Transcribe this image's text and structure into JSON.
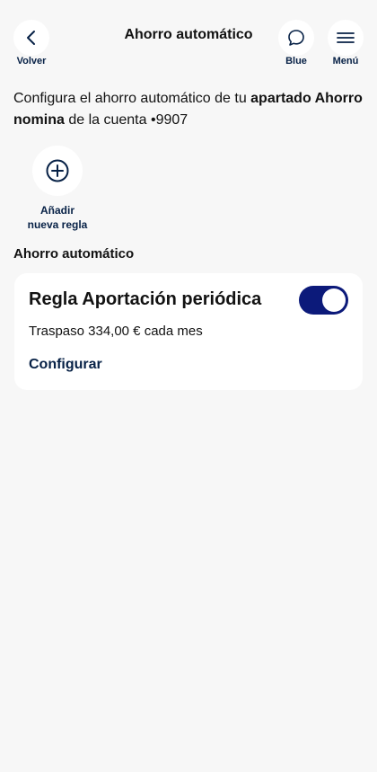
{
  "header": {
    "title": "Ahorro automático",
    "back_label": "Volver",
    "chat_label": "Blue",
    "menu_label": "Menú"
  },
  "intro": {
    "prefix": "Configura el ahorro automático de tu ",
    "bold_part": "apartado Ahorro nomina",
    "suffix": " de la cuenta •9907"
  },
  "add_rule": {
    "label": "Añadir nueva regla"
  },
  "section": {
    "title": "Ahorro automático"
  },
  "rule_card": {
    "title": "Regla Aportación periódica",
    "description": "Traspaso 334,00 € cada mes",
    "link_label": "Configurar",
    "enabled": true
  },
  "colors": {
    "background": "#f7f7f7",
    "brand_navy": "#072146",
    "toggle_on": "#0c1a7a",
    "card": "#ffffff"
  },
  "icons": {
    "back": "chevron-left-icon",
    "chat": "chat-bubble-icon",
    "menu": "hamburger-menu-icon",
    "add": "plus-circle-icon"
  }
}
